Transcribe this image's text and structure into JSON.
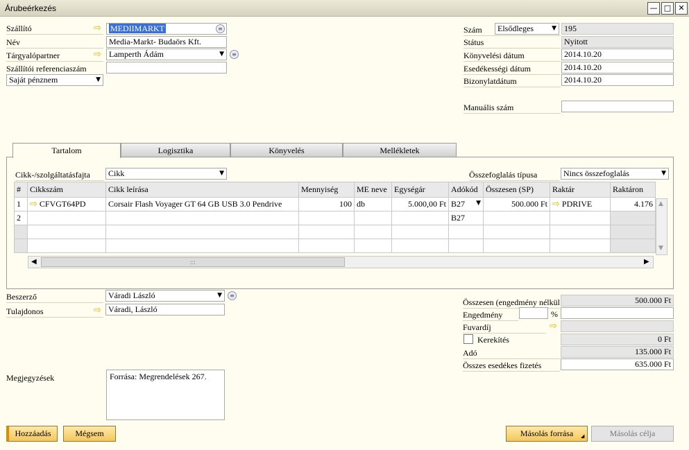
{
  "window": {
    "title": "Árubeérkezés",
    "minimize": "—",
    "maximize": "□",
    "close": "✕"
  },
  "header_left": {
    "supplier_label": "Szállító",
    "supplier_value": "MEDIIMARKT",
    "name_label": "Név",
    "name_value": "Media-Markt- Budaörs Kft.",
    "contact_label": "Tárgyalópartner",
    "contact_value": "Lamperth Ádám",
    "ref_label": "Szállítói referenciaszám",
    "ref_value": "",
    "currency_value": "Saját pénznem"
  },
  "header_right": {
    "number_label": "Szám",
    "series_value": "Elsődleges",
    "number_value": "195",
    "status_label": "Státus",
    "status_value": "Nyitott",
    "posting_label": "Könyvelési dátum",
    "posting_value": "2014.10.20",
    "due_label": "Esedékességi dátum",
    "due_value": "2014.10.20",
    "doc_label": "Bizonylatdátum",
    "doc_value": "2014.10.20",
    "manual_label": "Manuális szám",
    "manual_value": ""
  },
  "tabs": [
    "Tartalom",
    "Logisztika",
    "Könyvelés",
    "Mellékletek"
  ],
  "content": {
    "item_type_label": "Cikk-/szolgáltatásfajta",
    "item_type_value": "Cikk",
    "summary_label": "Összefoglalás típusa",
    "summary_value": "Nincs összefoglalás",
    "columns": [
      "#",
      "Cikkszám",
      "Cikk leírása",
      "Mennyiség",
      "ME neve",
      "Egységár",
      "Adókód",
      "Összesen (SP)",
      "Raktár",
      "Raktáron"
    ],
    "rows": [
      {
        "n": "1",
        "item": "CFVGT64PD",
        "desc": "Corsair Flash Voyager GT 64 GB USB 3.0 Pendrive",
        "qty": "100",
        "uom": "db",
        "price": "5.000,00 Ft",
        "tax": "B27",
        "total": "500.000 Ft",
        "wh": "PDRIVE",
        "stock": "4.176"
      },
      {
        "n": "2",
        "item": "",
        "desc": "",
        "qty": "",
        "uom": "",
        "price": "",
        "tax": "B27",
        "total": "",
        "wh": "",
        "stock": ""
      }
    ],
    "hscroll_grip": ":::"
  },
  "footer_left": {
    "buyer_label": "Beszerző",
    "buyer_value": "Váradi László",
    "owner_label": "Tulajdonos",
    "owner_value": "Váradi, László",
    "remarks_label": "Megjegyzések",
    "remarks_value": "Forrása: Megrendelések 267."
  },
  "totals": {
    "before_discount_label": "Összesen (engedmény nélkül)",
    "before_discount_value": "500.000 Ft",
    "discount_label": "Engedmény",
    "discount_pct": "",
    "discount_pct_sign": "%",
    "discount_value": "",
    "freight_label": "Fuvardíj",
    "freight_value": "",
    "rounding_label": "Kerekítés",
    "rounding_value": "0 Ft",
    "tax_label": "Adó",
    "tax_value": "135.000 Ft",
    "total_due_label": "Összes esedékes fizetés",
    "total_due_value": "635.000 Ft"
  },
  "buttons": {
    "add": "Hozzáadás",
    "cancel": "Mégsem",
    "copy_from": "Másolás forrása",
    "copy_to": "Másolás célja"
  },
  "icons": {
    "link_arrow": "arrow-right-icon",
    "dropdown": "chevron-down-icon",
    "choose": "list-choose-icon"
  },
  "colors": {
    "background": "#fffdf0",
    "link_arrow": "#e8b400",
    "button": "#f5c75b",
    "selection": "#3a6fd8"
  }
}
